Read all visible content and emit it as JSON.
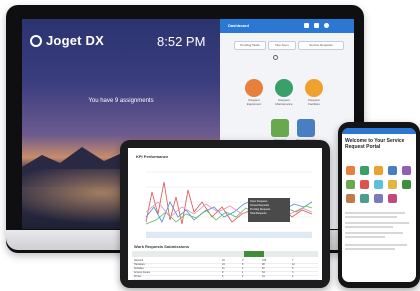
{
  "desktop": {
    "brand": "Joget DX",
    "clock": "8:52 PM",
    "message": "You have 9 assignments"
  },
  "app_panel": {
    "title": "Dashboard",
    "tabs": [
      "Pending Tasks",
      "Due Soon",
      "Service Requests"
    ],
    "tiles": [
      {
        "label": "Request Equipment",
        "color": "#e8803c"
      },
      {
        "label": "Request Maintenance",
        "color": "#3aa06a"
      },
      {
        "label": "Request Facilities",
        "color": "#f0a02c"
      },
      {
        "label": "Request Support",
        "color": "#6aa84f"
      },
      {
        "label": "Request Items",
        "color": "#4a7ec2"
      }
    ]
  },
  "tablet": {
    "chart_title": "KPI Performance",
    "table_title": "Work Requests Submissions",
    "tooltip": [
      "Open Requests",
      "Closed Requests",
      "Pending Requests",
      "Total Requests"
    ],
    "table_rows": [
      [
        "Network",
        "16",
        "3",
        "105",
        "7"
      ],
      [
        "Hardware",
        "24",
        "8",
        "98",
        "12"
      ],
      [
        "Software",
        "11",
        "2",
        "87",
        "5"
      ],
      [
        "Access Issues",
        "9",
        "1",
        "64",
        "3"
      ],
      [
        "Printer",
        "6",
        "2",
        "41",
        "4"
      ],
      [
        "Other",
        "3",
        "0",
        "22",
        "1"
      ]
    ]
  },
  "phone": {
    "heading": "Welcome to Your Service Request Portal"
  }
}
